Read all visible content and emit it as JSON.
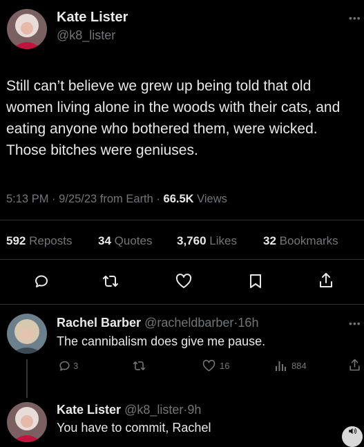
{
  "main_tweet": {
    "name": "Kate Lister",
    "handle": "@k8_lister",
    "text": "Still can’t believe we grew up being told that old women living alone in the woods with their cats, and eating anyone who bothered them, were wicked. Those bitches were geniuses.",
    "time": "5:13 PM",
    "date": "9/25/23",
    "source": "from Earth",
    "views_count": "66.5K",
    "views_label": "Views",
    "stats": {
      "reposts_count": "592",
      "reposts_label": "Reposts",
      "quotes_count": "34",
      "quotes_label": "Quotes",
      "likes_count": "3,760",
      "likes_label": "Likes",
      "bookmarks_count": "32",
      "bookmarks_label": "Bookmarks"
    }
  },
  "reply_1": {
    "name": "Rachel Barber",
    "handle": "@racheldbarber",
    "age": "16h",
    "text": "The cannibalism does give me pause.",
    "replies": "3",
    "likes": "16",
    "views": "884"
  },
  "reply_2": {
    "name": "Kate Lister",
    "handle": "@k8_lister",
    "age": "9h",
    "text": "You have to commit, Rachel"
  },
  "separator": "·",
  "icons": [
    "more-icon",
    "reply-icon",
    "repost-icon",
    "like-icon",
    "bookmark-icon",
    "share-icon",
    "views-icon",
    "sound-icon"
  ],
  "colors": {
    "background": "#000000",
    "text": "#e7e9ea",
    "muted": "#71767b",
    "divider": "#2f3336"
  }
}
